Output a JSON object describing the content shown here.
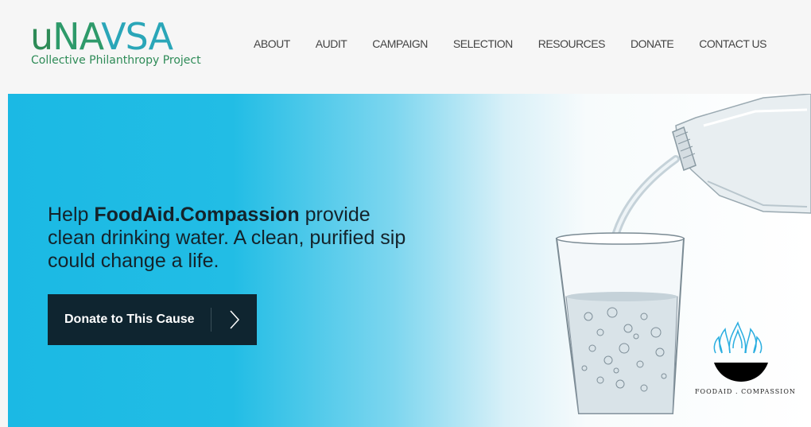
{
  "header": {
    "logo_mark": "uNAVSA",
    "logo_parts": {
      "u": "u",
      "na": "NA",
      "vsa": "VSA"
    },
    "tagline": "Collective Philanthropy Project"
  },
  "nav": {
    "items": [
      "ABOUT",
      "AUDIT",
      "CAMPAIGN",
      "SELECTION",
      "RESOURCES",
      "DONATE",
      "CONTACT US"
    ]
  },
  "hero": {
    "text_pre": "Help ",
    "text_bold": "FoodAid.Compassion",
    "text_post": " provide clean drinking water. A clean, purified sip could change a life.",
    "button_label": "Donate to This Cause",
    "brand_label": "FOODAID . COMPASSION"
  },
  "colors": {
    "logo_green": "#2e8b57",
    "logo_teal": "#2aa6b8",
    "hero_blue": "#1bb9e4",
    "button_bg": "#0f2530"
  },
  "icons": {
    "button_arrow": "chevron-right-icon",
    "brand_logo": "lotus-flame-bowl-icon"
  }
}
